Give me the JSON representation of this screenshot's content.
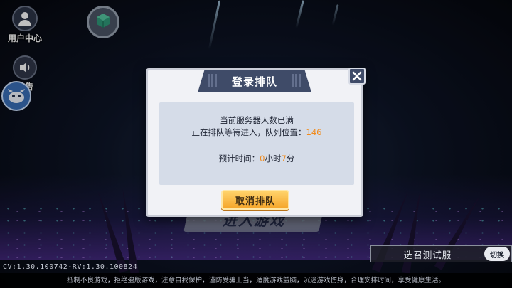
{
  "top_left": {
    "user_center_label": "用户中心",
    "notice_label": "公告"
  },
  "dialog": {
    "title": "登录排队",
    "line1": "当前服务器人数已满",
    "line2_prefix": "正在排队等待进入，队列位置：",
    "queue_position": "146",
    "est_label": "预计时间：",
    "est_hours": "0",
    "est_hours_unit": "小时",
    "est_minutes": "7",
    "est_minutes_unit": "分",
    "cancel_label": "取消排队"
  },
  "background_button": {
    "label": "进入游戏"
  },
  "server": {
    "label": "选召测试服",
    "switch_label": "切换"
  },
  "version": "CV:1.30.100742-RV:1.30.100824",
  "footer": "抵制不良游戏，拒绝盗版游戏，注意自我保护，谨防受骗上当，适度游戏益脑，沉迷游戏伤身，合理安排时间，享受健康生活。",
  "colors": {
    "highlight": "#f08a1c",
    "dialog_header": "#3f4b68",
    "cancel_button": "#f5a52a"
  },
  "icons": [
    "user-icon",
    "speaker-icon",
    "digimon-avatar-icon",
    "cube-icon",
    "close-icon"
  ]
}
